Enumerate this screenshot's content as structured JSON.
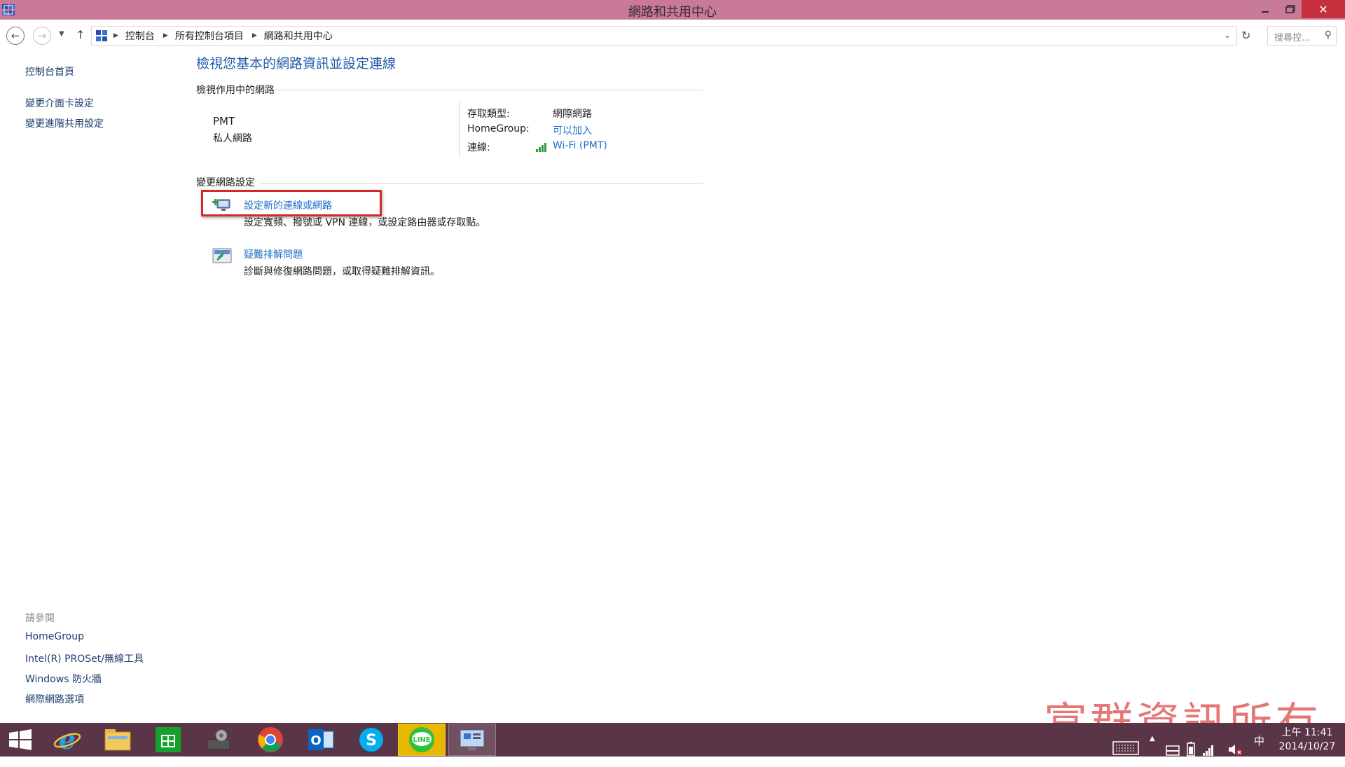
{
  "window": {
    "title": "網路和共用中心",
    "minimize_icon": "minimize-icon",
    "maximize_icon": "maximize-icon",
    "close_icon": "close-icon",
    "close_color": "#c7303f",
    "titlebar_color": "#c87a98"
  },
  "address": {
    "breadcrumbs": [
      "控制台",
      "所有控制台項目",
      "網路和共用中心"
    ],
    "search_placeholder": "搜尋控..."
  },
  "sidebar": {
    "items": [
      "控制台首頁",
      "變更介面卡設定",
      "變更進階共用設定"
    ],
    "see_also_title": "請參閱",
    "see_also": [
      "HomeGroup",
      "Intel(R) PROSet/無線工具",
      "Windows 防火牆",
      "網際網路選項"
    ]
  },
  "main": {
    "heading": "檢視您基本的網路資訊並設定連線",
    "active_networks_title": "檢視作用中的網路",
    "network": {
      "name": "PMT",
      "category": "私人網路",
      "access_type_label": "存取類型:",
      "access_type_value": "網際網路",
      "homegroup_label": "HomeGroup:",
      "homegroup_value": "可以加入",
      "connection_label": "連線:",
      "connection_value": "Wi-Fi (PMT)"
    },
    "change_settings_title": "變更網路設定",
    "tasks": [
      {
        "title": "設定新的連線或網路",
        "desc": "設定寬頻、撥號或 VPN 連線，或設定路由器或存取點。"
      },
      {
        "title": "疑難排解問題",
        "desc": "診斷與修復網路問題，或取得疑難排解資訊。"
      }
    ]
  },
  "watermark": "富群資訊所有",
  "taskbar": {
    "apps": [
      "start-icon",
      "internet-explorer-icon",
      "file-explorer-icon",
      "store-icon",
      "network-settings-icon",
      "chrome-icon",
      "outlook-icon",
      "skype-icon",
      "line-icon",
      "control-panel-icon"
    ],
    "ime": "中",
    "time": "上午 11:41",
    "date": "2014/10/27"
  }
}
